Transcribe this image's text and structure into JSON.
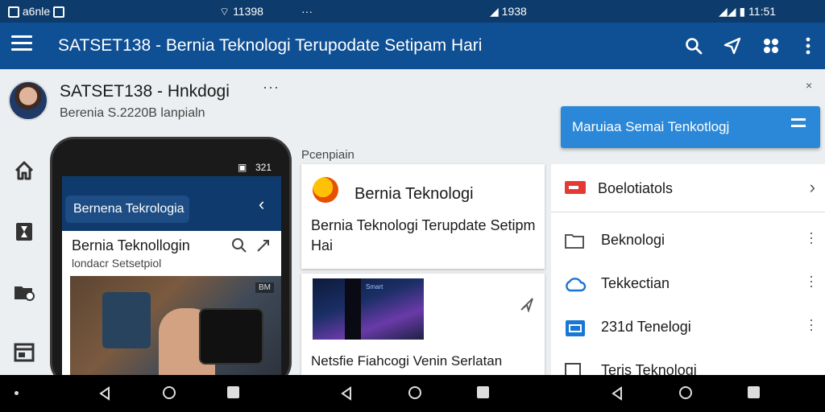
{
  "status_bar": {
    "left_text": "a6nle",
    "signal_text": "11398",
    "dots": "···",
    "mid_text": "1938",
    "time": "11:51"
  },
  "app_bar": {
    "title": "SATSET138 - Bernia Teknologi Terupodate Setipam Hari",
    "icons": [
      "menu-icon",
      "search-icon",
      "send-icon",
      "share-icon",
      "more-vert-icon"
    ]
  },
  "profile": {
    "name": "SATSET138 - Hnkdogi",
    "subtitle": "Berenia S.2220B lanpialn",
    "more": "···",
    "close": "×"
  },
  "rail": [
    "home-icon",
    "hourglass-icon",
    "folder-icon",
    "browser-window-icon"
  ],
  "phone": {
    "status_text": "321",
    "header_pill": "Bernena Tekrologia",
    "back": "‹",
    "headline": "Bernia Teknollogin",
    "subline": "londacr Setsetpiol",
    "image_tag": "BM"
  },
  "section_label": "Pcenpiain",
  "card_news": {
    "title": "Bernia Teknologi",
    "body": "Bernia Teknologi Terupdate Setipm Hai"
  },
  "card_article": {
    "image_label": "Smart",
    "text": "Netsfie Fiahcogi Venin Serlatan tenpplahadontan Kenlododnen"
  },
  "cta": {
    "label": "Maruiaa Semai Tenkotlogj",
    "accent": "#2b88d8"
  },
  "list": {
    "first": {
      "label": "Boelotiatols",
      "icon": "tag-icon",
      "color": "#e53935"
    },
    "items": [
      {
        "label": "Beknologi",
        "icon": "folder-icon"
      },
      {
        "label": "Tekkectian",
        "icon": "cloud-icon"
      },
      {
        "label": "231d Tenelogi",
        "icon": "monitor-icon"
      },
      {
        "label": "Terjs Teknologi",
        "icon": "edit-icon"
      }
    ]
  },
  "nav_bar": [
    "dot-indicator",
    "back-button",
    "home-button",
    "recents-button"
  ],
  "colors": {
    "status_bar": "#0d3b6b",
    "app_bar": "#0f4f93",
    "background": "#eceff1"
  }
}
